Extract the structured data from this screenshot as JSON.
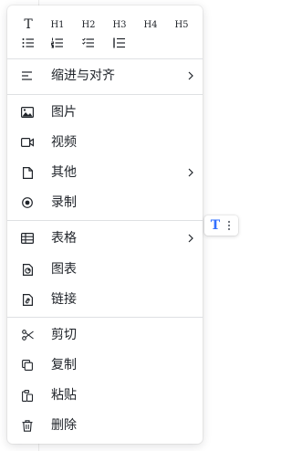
{
  "toolbar": {
    "row1": [
      {
        "label": "T",
        "icon": "text-icon"
      },
      {
        "label": "H1",
        "icon": "heading-1-icon"
      },
      {
        "label": "H2",
        "icon": "heading-2-icon"
      },
      {
        "label": "H3",
        "icon": "heading-3-icon"
      },
      {
        "label": "H4",
        "icon": "heading-4-icon"
      },
      {
        "label": "H5",
        "icon": "heading-5-icon"
      }
    ],
    "row2": [
      {
        "icon": "bullet-list-icon"
      },
      {
        "icon": "numbered-list-icon"
      },
      {
        "icon": "task-list-icon"
      },
      {
        "icon": "quote-icon"
      }
    ]
  },
  "menu": {
    "indent_align": "缩进与对齐",
    "image": "图片",
    "video": "视频",
    "other": "其他",
    "record": "录制",
    "table": "表格",
    "chart": "图表",
    "link": "链接",
    "cut": "剪切",
    "copy": "复制",
    "paste": "粘贴",
    "delete": "删除"
  },
  "floating": {
    "block_type": "T",
    "accent_color": "#3370ff"
  },
  "colors": {
    "text": "#1f2329",
    "divider": "#dee0e3",
    "icon": "#1f2329"
  }
}
